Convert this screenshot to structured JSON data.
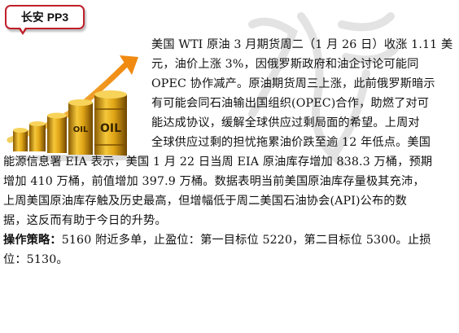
{
  "tag": {
    "label": "长安 PP3"
  },
  "article": {
    "lines": [
      "美国 WTI 原油 3 月期货周二（1 月 26 日）收涨 1.11 美",
      "元，油价上涨 3%，因俄罗斯政府和油企讨论可能同",
      "OPEC 协作减产。原油期货周三上涨，此前俄罗斯暗示",
      "有可能会同石油输出国组织(OPEC)合作，助燃了对可",
      "能达成协议，缓解全球供应过剩局面的希望。上周对",
      "全球供应过剩的担忧拖累油价跌至逾 12 年低点。美国",
      "能源信息署 EIA 表示，美国 1 月 22 日当周  EIA 原油库存增加 838.3 万桶，预期",
      "增加 410 万桶，前值增加 397.9 万桶。数据表明当前美国原油库存量极其充沛，",
      "上周美国原油库存触及历史最高，但增幅低于周二美国石油协会(API)公布的数",
      "据，这反而有助于今日的升势。"
    ]
  },
  "strategy": {
    "label": "操作策略：",
    "text": "5160 附近多单，止盈位：第一目标位 5220，第二目标位 5300。止损",
    "text2": "位：5130。"
  },
  "illustration": {
    "barrel_text": "OIL",
    "icon": "oil-barrels-rising-arrow-icon"
  }
}
